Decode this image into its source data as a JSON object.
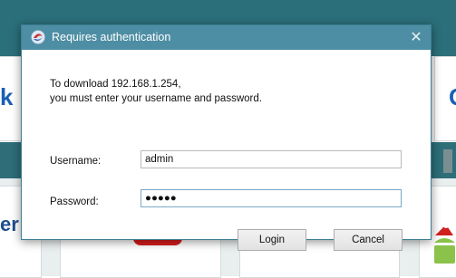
{
  "dialog": {
    "title": "Requires authentication",
    "close_glyph": "✕",
    "message_line1": "To download 192.168.1.254,",
    "message_line2": "you must enter your username and password.",
    "username_label": "Username:",
    "username_value": "admin",
    "password_label": "Password:",
    "password_value": "●●●●●",
    "login_label": "Login",
    "cancel_label": "Cancel"
  },
  "background": {
    "left_letter": "k",
    "right_letter": "G",
    "left_bottom_text": "er"
  },
  "colors": {
    "titlebar": "#4d8ea4",
    "background_band": "#2b6f7a"
  }
}
